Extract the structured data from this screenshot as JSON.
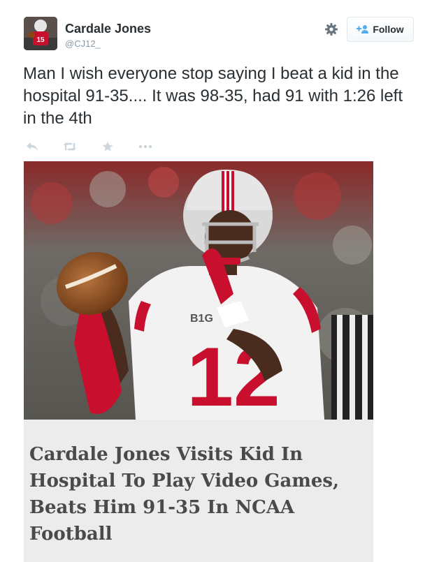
{
  "tweet": {
    "author_name": "Cardale Jones",
    "author_handle": "@CJ12_",
    "follow_label": "Follow",
    "text": "Man I wish everyone stop saying I beat a kid in the hospital 91-35.... It was 98-35, had 91 with 1:26 left in the 4th"
  },
  "actions": [
    {
      "name": "reply-icon"
    },
    {
      "name": "retweet-icon"
    },
    {
      "name": "favorite-icon"
    },
    {
      "name": "more-icon"
    }
  ],
  "media": {
    "jersey_number": "12",
    "conference_logo": "B1G",
    "caption": "Cardale Jones Visits Kid In Hospital To Play Video Games, Beats Him 91-35 In NCAA Football"
  },
  "colors": {
    "action_icon": "#ccd6dd",
    "follow_icon": "#55acee",
    "ohio_red": "#c8102e",
    "caption_text": "#4a4a4a"
  }
}
